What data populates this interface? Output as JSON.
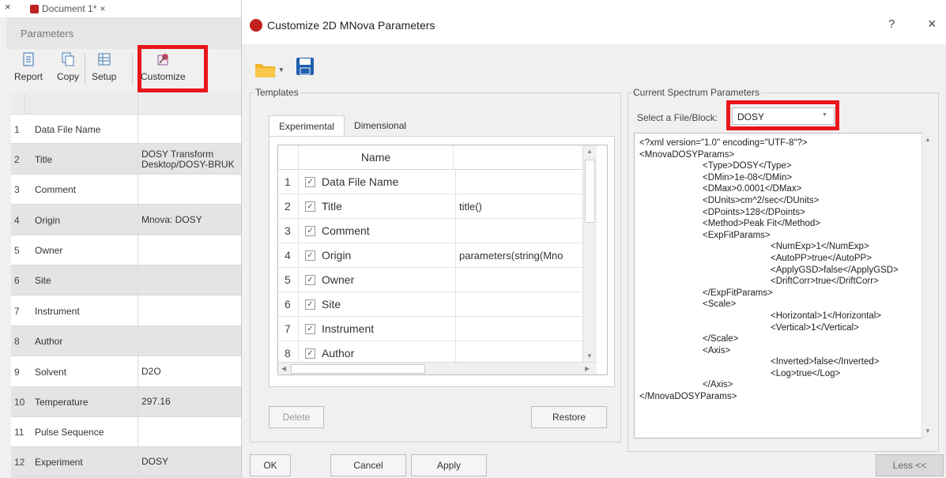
{
  "background_window": {
    "document_tab": "Document 1*",
    "tab_close_glyph": "×",
    "panel_title": "Parameters",
    "toolbar": {
      "report": "Report",
      "copy": "Copy",
      "setup": "Setup",
      "customize": "Customize"
    },
    "rows": [
      {
        "num": "1",
        "name": "Data File Name",
        "value": ""
      },
      {
        "num": "2",
        "name": "Title",
        "value": "DOSY Transform\nDesktop/DOSY-BRUK"
      },
      {
        "num": "3",
        "name": "Comment",
        "value": ""
      },
      {
        "num": "4",
        "name": "Origin",
        "value": "Mnova: DOSY"
      },
      {
        "num": "5",
        "name": "Owner",
        "value": ""
      },
      {
        "num": "6",
        "name": "Site",
        "value": ""
      },
      {
        "num": "7",
        "name": "Instrument",
        "value": ""
      },
      {
        "num": "8",
        "name": "Author",
        "value": ""
      },
      {
        "num": "9",
        "name": "Solvent",
        "value": "D2O"
      },
      {
        "num": "10",
        "name": "Temperature",
        "value": "297.16"
      },
      {
        "num": "11",
        "name": "Pulse Sequence",
        "value": ""
      },
      {
        "num": "12",
        "name": "Experiment",
        "value": "DOSY"
      }
    ]
  },
  "dialog": {
    "title": "Customize 2D MNova Parameters",
    "help_glyph": "?",
    "close_glyph": "×",
    "templates": {
      "legend": "Templates",
      "tabs": [
        "Experimental",
        "Dimensional"
      ],
      "column_name": "Name",
      "rows": [
        {
          "num": "1",
          "checked": true,
          "name": "Data File Name",
          "expr": ""
        },
        {
          "num": "2",
          "checked": true,
          "name": "Title",
          "expr": "title()"
        },
        {
          "num": "3",
          "checked": true,
          "name": "Comment",
          "expr": ""
        },
        {
          "num": "4",
          "checked": true,
          "name": "Origin",
          "expr": "parameters(string(Mno"
        },
        {
          "num": "5",
          "checked": true,
          "name": "Owner",
          "expr": ""
        },
        {
          "num": "6",
          "checked": true,
          "name": "Site",
          "expr": ""
        },
        {
          "num": "7",
          "checked": true,
          "name": "Instrument",
          "expr": ""
        },
        {
          "num": "8",
          "checked": true,
          "name": "Author",
          "expr": ""
        }
      ],
      "delete": "Delete",
      "restore": "Restore"
    },
    "current": {
      "legend": "Current Spectrum Parameters",
      "select_label": "Select a File/Block:",
      "select_value": "DOSY",
      "xml": [
        {
          "indent": 0,
          "text": "<?xml version=\"1.0\" encoding=\"UTF-8\"?>"
        },
        {
          "indent": 0,
          "text": "<MnovaDOSYParams>"
        },
        {
          "indent": 1,
          "text": "<Type>DOSY</Type>"
        },
        {
          "indent": 1,
          "text": "<DMin>1e-08</DMin>"
        },
        {
          "indent": 1,
          "text": "<DMax>0.0001</DMax>"
        },
        {
          "indent": 1,
          "text": "<DUnits>cm^2/sec</DUnits>"
        },
        {
          "indent": 1,
          "text": "<DPoints>128</DPoints>"
        },
        {
          "indent": 1,
          "text": "<Method>Peak Fit</Method>"
        },
        {
          "indent": 1,
          "text": "<ExpFitParams>"
        },
        {
          "indent": 2,
          "text": "<NumExp>1</NumExp>"
        },
        {
          "indent": 2,
          "text": "<AutoPP>true</AutoPP>"
        },
        {
          "indent": 2,
          "text": "<ApplyGSD>false</ApplyGSD>"
        },
        {
          "indent": 2,
          "text": "<DriftCorr>true</DriftCorr>"
        },
        {
          "indent": 1,
          "text": "</ExpFitParams>"
        },
        {
          "indent": 1,
          "text": "<Scale>"
        },
        {
          "indent": 2,
          "text": "<Horizontal>1</Horizontal>"
        },
        {
          "indent": 2,
          "text": "<Vertical>1</Vertical>"
        },
        {
          "indent": 1,
          "text": "</Scale>"
        },
        {
          "indent": 1,
          "text": "<Axis>"
        },
        {
          "indent": 2,
          "text": "<Inverted>false</Inverted>"
        },
        {
          "indent": 2,
          "text": "<Log>true</Log>"
        },
        {
          "indent": 1,
          "text": "</Axis>"
        },
        {
          "indent": 0,
          "text": "</MnovaDOSYParams>"
        }
      ]
    },
    "footer": {
      "ok": "OK",
      "cancel": "Cancel",
      "apply": "Apply",
      "less": "Less <<"
    }
  },
  "colors": {
    "highlight_red": "#e8151b",
    "mnova_red": "#c0201e",
    "folder_yellow": "#f0b428",
    "save_blue": "#1f5fae"
  }
}
